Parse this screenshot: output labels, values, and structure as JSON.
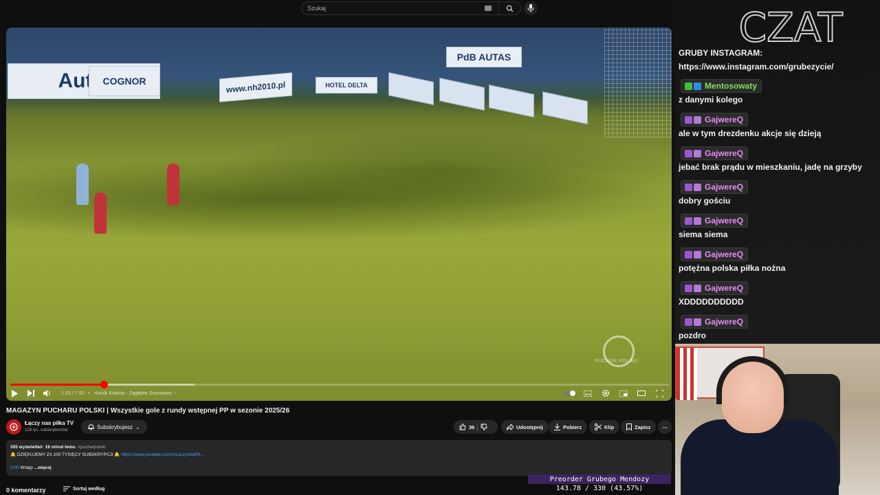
{
  "search": {
    "placeholder": "Szukaj"
  },
  "player": {
    "time": "1:03 / 7:33",
    "chapter": "Hutnik Kraków - Zagłębie Sosnowiec",
    "progress_fraction": 0.142,
    "buffer_fraction": 0.28
  },
  "video": {
    "title": "MAGAZYN PUCHARU POLSKI | Wszystkie gole z rundy wstępnej PP w sezonie 2025/26",
    "banners": {
      "autel": "Autel",
      "cognor": "COGNOR",
      "nh": "www.nh2010.pl",
      "hotel": "HOTEL DELTA",
      "pdb": "PdB AUTAS"
    },
    "watermark": "PUCHAR POLSKI"
  },
  "channel": {
    "name": "Łączy nas piłka TV",
    "subs": "129 tys. subskrybentów"
  },
  "actions": {
    "subscribe": "Subskrybujesz",
    "likes": "36",
    "share": "Udostępnij",
    "download": "Pobierz",
    "clip": "Klip",
    "save": "Zapisz"
  },
  "description": {
    "views": "355 wyświetleń",
    "ago": "16 minut temu",
    "hashtag": "#pucharpolski",
    "line2": "🔔 DZIĘKUJEMY ZA 100 TYSIĘCY SUBSKRYPCJI 🔔",
    "link": "https://www.youtube.com/c/LaczyNasPil...",
    "ts": "0:00",
    "intro": "Wstęp",
    "more": "...więcej"
  },
  "comments": {
    "count": "0 komentarzy",
    "sort": "Sortuj według"
  },
  "chat": {
    "header": "CZAT",
    "pinned_line1": "GRUBY INSTAGRAM:",
    "pinned_line2": "https://www.instagram.com/grubezycie/",
    "messages": [
      {
        "user": "Mentosowaty",
        "user_color": "#7fe05a",
        "text": "z danymi kolego"
      },
      {
        "user": "GajwereQ",
        "user_color": "#e58cf5",
        "text": "ale w tym drezdenku akcje się dzieją"
      },
      {
        "user": "GajwereQ",
        "user_color": "#e58cf5",
        "text": "jebać brak prądu w mieszkaniu, jadę na grzyby"
      },
      {
        "user": "GajwereQ",
        "user_color": "#e58cf5",
        "text": "dobry gościu"
      },
      {
        "user": "GajwereQ",
        "user_color": "#e58cf5",
        "text": "siema siema"
      },
      {
        "user": "GajwereQ",
        "user_color": "#e58cf5",
        "text": "potężna polska piłka nożna"
      },
      {
        "user": "GajwereQ",
        "user_color": "#e58cf5",
        "text": "XDDDDDDDDDD"
      },
      {
        "user": "GajwereQ",
        "user_color": "#e58cf5",
        "text": "pozdro"
      }
    ]
  },
  "overlay": {
    "preorder": "Preorder Grubego Mendozy",
    "counter": "143.78 / 330 (43.57%)"
  },
  "colors": {
    "accent_red": "#ff0000",
    "link": "#3ea6ff",
    "preorder_bg": "#3d2460"
  }
}
